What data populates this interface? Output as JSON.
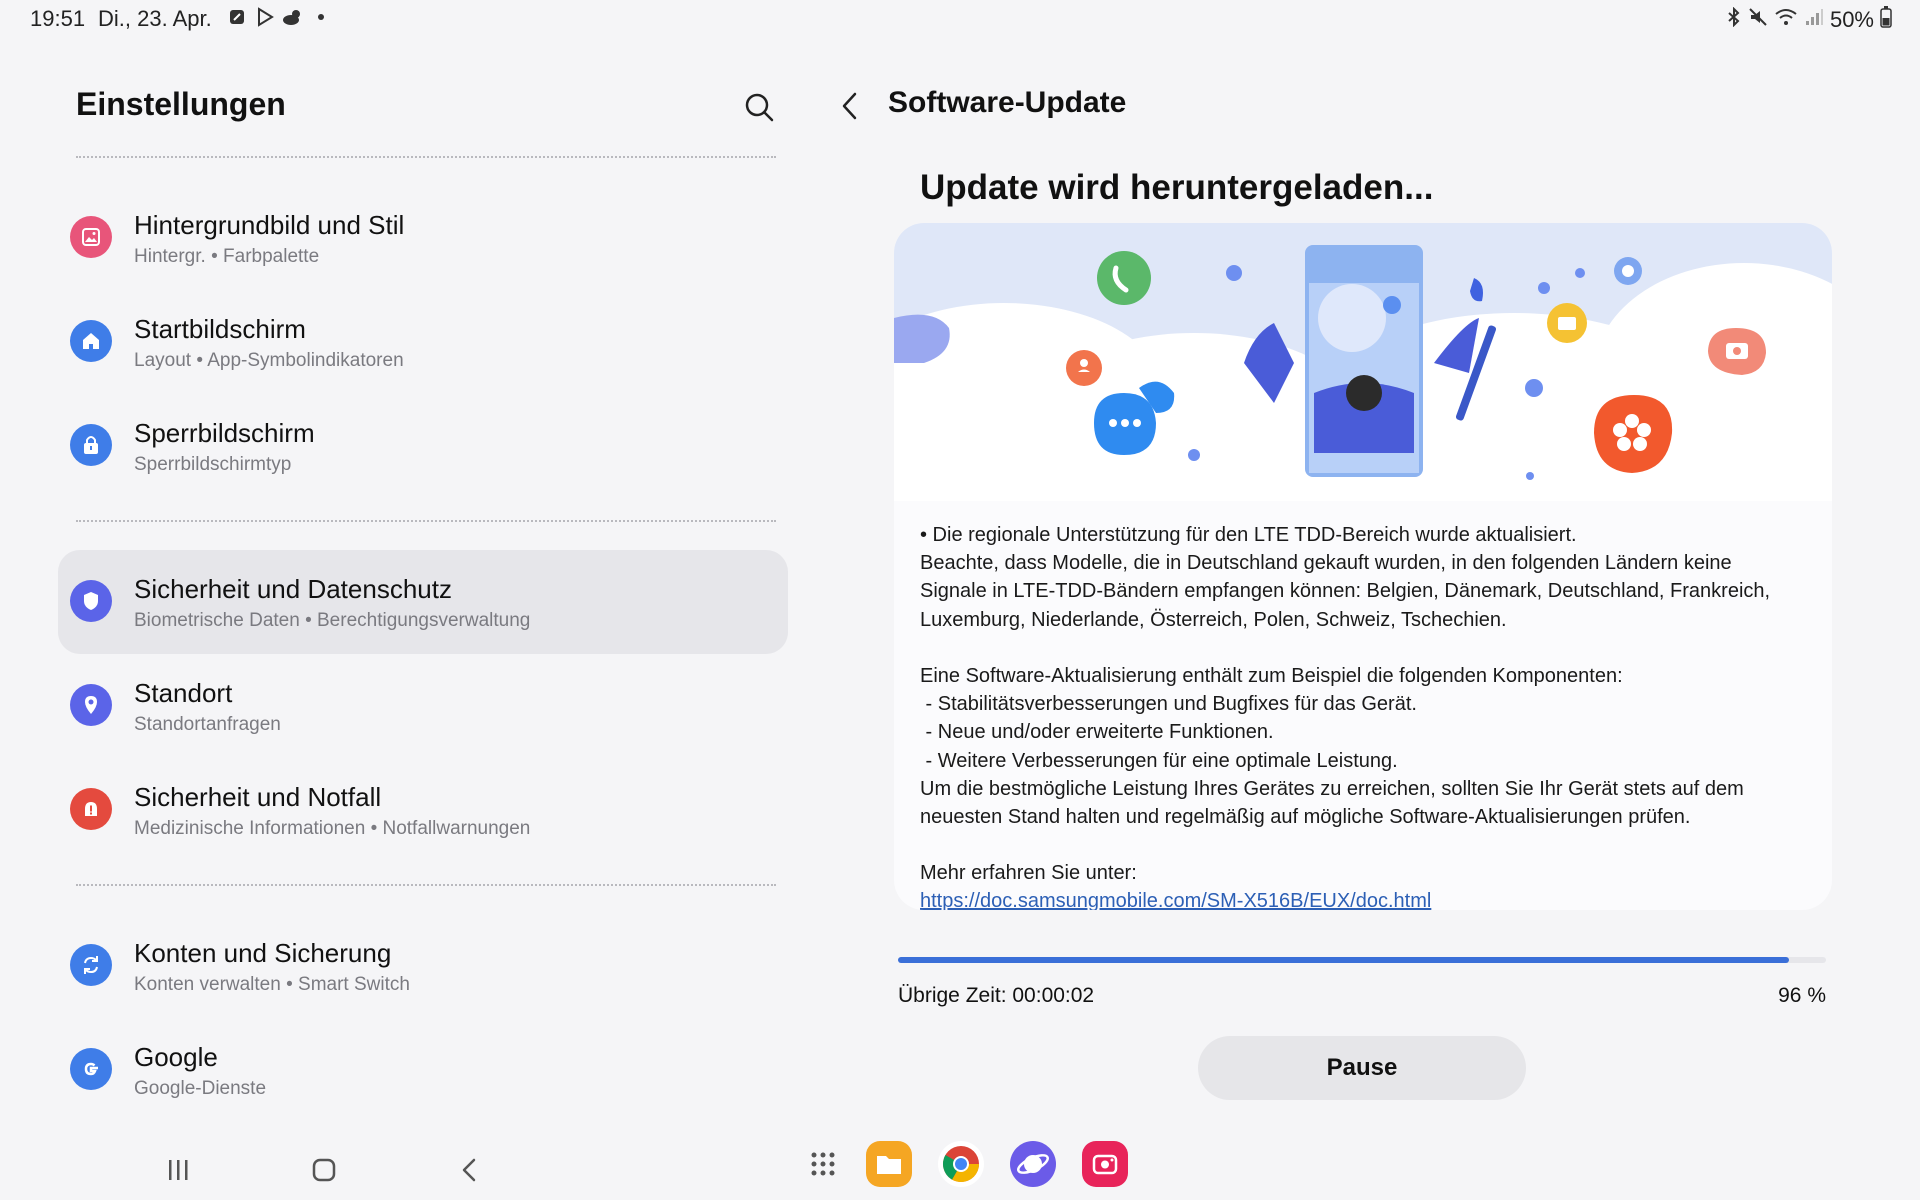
{
  "status_bar": {
    "time": "19:51",
    "date": "Di., 23. Apr.",
    "battery": "50%",
    "icons": [
      "app-icon",
      "play-store-icon",
      "weather-icon",
      "dot-icon",
      "bluetooth-icon",
      "mute-icon",
      "wifi-icon",
      "signal-icon",
      "battery-icon"
    ]
  },
  "left_panel": {
    "title": "Einstellungen",
    "items": [
      {
        "title": "Hintergrundbild und Stil",
        "subtitle": "Hintergr.  •  Farbpalette",
        "icon": "wallpaper-icon",
        "color": "#e8557a"
      },
      {
        "title": "Startbildschirm",
        "subtitle": "Layout  •  App-Symbolindikatoren",
        "icon": "home-icon",
        "color": "#3f7de8"
      },
      {
        "title": "Sperrbildschirm",
        "subtitle": "Sperrbildschirmtyp",
        "icon": "lock-icon",
        "color": "#3f7de8"
      },
      {
        "title": "Sicherheit und Datenschutz",
        "subtitle": "Biometrische Daten  •  Berechtigungsverwaltung",
        "icon": "shield-icon",
        "color": "#5b64e8",
        "selected": true
      },
      {
        "title": "Standort",
        "subtitle": "Standortanfragen",
        "icon": "location-icon",
        "color": "#5b64e8"
      },
      {
        "title": "Sicherheit und Notfall",
        "subtitle": "Medizinische Informationen  •  Notfallwarnungen",
        "icon": "emergency-icon",
        "color": "#e44a3e"
      },
      {
        "title": "Konten und Sicherung",
        "subtitle": "Konten verwalten  •  Smart Switch",
        "icon": "sync-icon",
        "color": "#3f7de8"
      },
      {
        "title": "Google",
        "subtitle": "Google-Dienste",
        "icon": "google-icon",
        "color": "#3f7de8"
      }
    ]
  },
  "right_panel": {
    "title": "Software-Update",
    "heading": "Update wird heruntergeladen...",
    "lines": [
      "• Die regionale Unterstützung für den LTE TDD-Bereich wurde aktualisiert.",
      "Beachte, dass Modelle, die in Deutschland gekauft wurden, in den folgenden Ländern keine",
      "Signale in LTE-TDD-Bändern empfangen können: Belgien, Dänemark, Deutschland, Frankreich,",
      "Luxemburg, Niederlande, Österreich, Polen, Schweiz, Tschechien.",
      "",
      "Eine Software-Aktualisierung enthält zum Beispiel die folgenden Komponenten:",
      " - Stabilitätsverbesserungen und Bugfixes für das Gerät.",
      " - Neue und/oder erweiterte Funktionen.",
      " - Weitere Verbesserungen für eine optimale Leistung.",
      "Um die bestmögliche Leistung Ihres Gerätes zu erreichen, sollten Sie Ihr Gerät stets auf dem",
      "neuesten Stand halten und regelmäßig auf mögliche Software-Aktualisierungen prüfen.",
      "",
      "Mehr erfahren Sie unter:"
    ],
    "link": "https://doc.samsungmobile.com/SM-X516B/EUX/doc.html",
    "progress_fraction": 0.96,
    "remaining_time": "Übrige Zeit: 00:00:02",
    "percent": "96 %",
    "pause_label": "Pause"
  },
  "nav_bar": {
    "buttons": [
      "recents-icon",
      "home-button-icon",
      "back-icon"
    ],
    "dock": [
      "app-drawer-icon",
      "my-files-icon",
      "chrome-icon",
      "samsung-internet-icon",
      "screen-recorder-icon"
    ]
  }
}
